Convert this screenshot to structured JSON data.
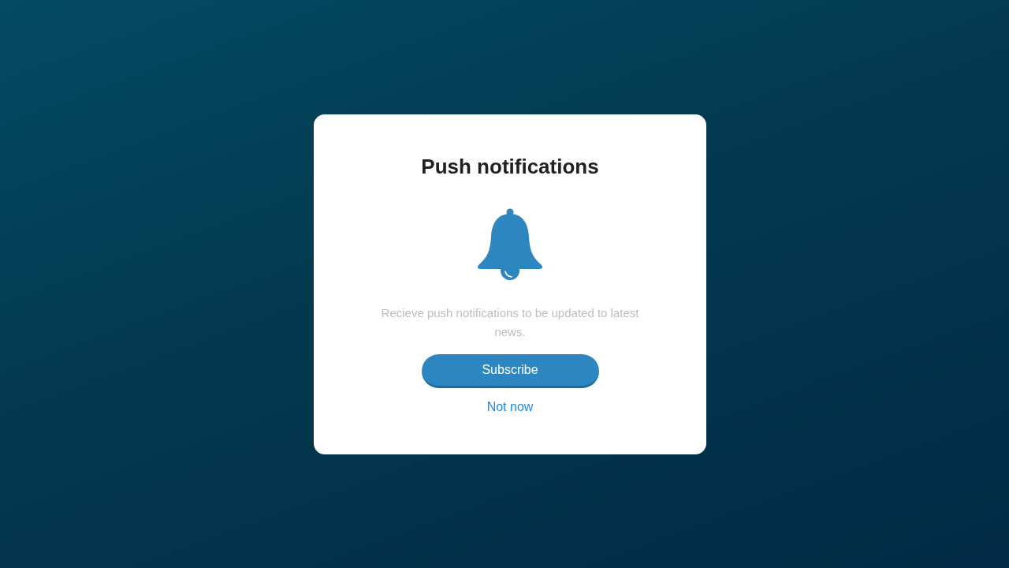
{
  "dialog": {
    "title": "Push notifications",
    "message": "Recieve push notifications to be updated to latest news.",
    "buttons": [
      {
        "label": "Subscribe",
        "kind": "primary"
      },
      {
        "label": "Not now",
        "kind": "link"
      }
    ]
  }
}
